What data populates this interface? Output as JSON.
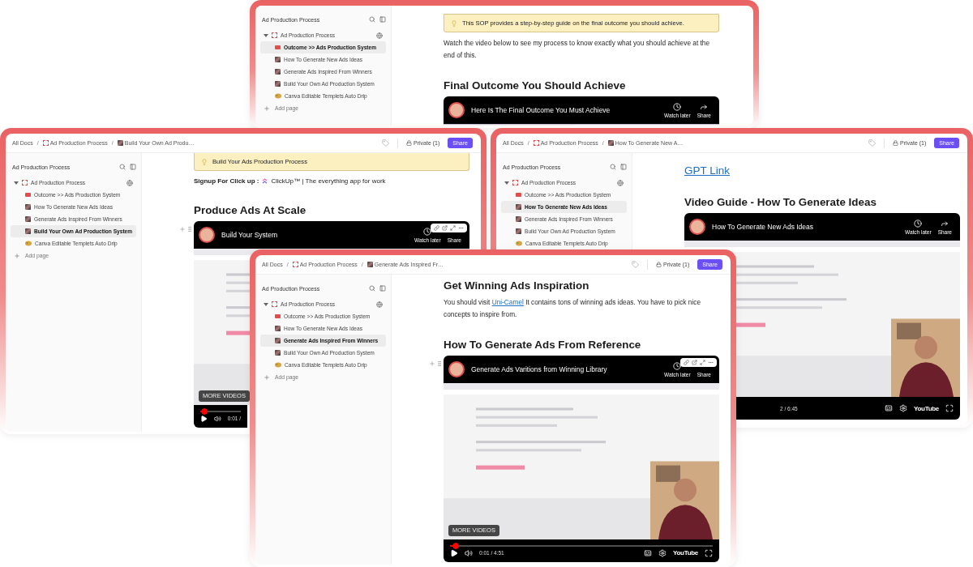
{
  "windows": [
    {
      "sidebar": {
        "title": "Ad Production Process",
        "root": {
          "label": "Ad Production Process",
          "expanded": true,
          "children": [
            {
              "label": "Outcome >> Ads Production System",
              "kind": "card",
              "selected": true
            },
            {
              "label": "How To Generate New Ads Ideas",
              "kind": "thumb",
              "selected": false
            },
            {
              "label": "Generate Ads Inspired From Winners",
              "kind": "thumb",
              "selected": false
            },
            {
              "label": "Build Your Own Ad Production System",
              "kind": "thumb",
              "selected": false
            },
            {
              "label": "Canva Editable Templets Auto Drip",
              "kind": "palette",
              "selected": false
            }
          ]
        },
        "add_page": "Add page"
      },
      "content": [
        {
          "kind": "callout",
          "text": "This SOP provides a step-by-step guide on the final outcome you should achieve."
        },
        {
          "kind": "paragraph",
          "parts": [
            {
              "text": "Watch the video below to see my process to know exactly what you should achieve at the end of this."
            }
          ]
        },
        {
          "kind": "heading",
          "text": "Final Outcome You Should Achieve"
        },
        {
          "kind": "video",
          "title": "Here Is The Final Outcome You Must Achieve",
          "watch_later": "Watch later",
          "share": "Share",
          "hovered": false
        }
      ]
    },
    {
      "topbar": {
        "breadcrumb": [
          {
            "kind": "plain",
            "label": "All Docs"
          },
          {
            "kind": "separator",
            "label": "/"
          },
          {
            "kind": "folder",
            "label": "Ad Production Process"
          },
          {
            "kind": "separator",
            "label": "/"
          },
          {
            "kind": "page",
            "label": "Build Your Own Ad Produ…"
          }
        ],
        "private": "Private (1)",
        "share": "Share"
      },
      "sidebar": {
        "title": "Ad Production Process",
        "root": {
          "label": "Ad Production Process",
          "expanded": true,
          "children": [
            {
              "label": "Outcome >> Ads Production System",
              "kind": "card",
              "selected": false
            },
            {
              "label": "How To Generate New Ads Ideas",
              "kind": "thumb",
              "selected": false
            },
            {
              "label": "Generate Ads Inspired From Winners",
              "kind": "thumb",
              "selected": false
            },
            {
              "label": "Build Your Own Ad Production System",
              "kind": "thumb",
              "selected": true
            },
            {
              "label": "Canva Editable Templets Auto Drip",
              "kind": "palette",
              "selected": false
            }
          ]
        },
        "add_page": "Add page"
      },
      "content": [
        {
          "kind": "callout",
          "text": "Build Your Ads Production Process"
        },
        {
          "kind": "signup",
          "label": "Signup For Click up :",
          "link": "ClickUp™ | The everything app for work"
        },
        {
          "kind": "heading",
          "text": "Produce Ads At Scale"
        },
        {
          "kind": "video",
          "title": "Build Your System",
          "watch_later": "Watch later",
          "share": "Share",
          "hovered": true,
          "more_videos": "MORE VIDEOS",
          "footer": {
            "level": 0.01,
            "items": [
              {
                "kind": "play"
              },
              {
                "kind": "volume"
              },
              {
                "kind": "time",
                "text": "0:01 /"
              }
            ]
          }
        }
      ]
    },
    {
      "topbar": {
        "breadcrumb": [
          {
            "kind": "plain",
            "label": "All Docs"
          },
          {
            "kind": "separator",
            "label": "/"
          },
          {
            "kind": "folder",
            "label": "Ad Production Process"
          },
          {
            "kind": "separator",
            "label": "/"
          },
          {
            "kind": "page",
            "label": "How To Generate New A…"
          }
        ],
        "private": "Private (1)",
        "share": "Share"
      },
      "sidebar": {
        "title": "Ad Production Process",
        "root": {
          "label": "Ad Production Process",
          "expanded": true,
          "children": [
            {
              "label": "Outcome >> Ads Production System",
              "kind": "card",
              "selected": false
            },
            {
              "label": "How To Generate New Ads Ideas",
              "kind": "thumb",
              "selected": true
            },
            {
              "label": "Generate Ads Inspired From Winners",
              "kind": "thumb",
              "selected": false
            },
            {
              "label": "Build Your Own Ad Production System",
              "kind": "thumb",
              "selected": false
            },
            {
              "label": "Canva Editable Templets Auto Drip",
              "kind": "palette",
              "selected": false
            }
          ]
        }
      },
      "content": [
        {
          "kind": "link_heading",
          "text": "GPT Link"
        },
        {
          "kind": "heading",
          "text": "Video Guide - How To Generate Ideas"
        },
        {
          "kind": "video",
          "title": "How To Generate New Ads Ideas",
          "watch_later": "Watch later",
          "share": "Share",
          "hovered": false,
          "footer": {
            "items": [
              {
                "kind": "time",
                "text": "2 / 6:45"
              },
              {
                "kind": "cc"
              },
              {
                "kind": "settings"
              },
              {
                "kind": "logo",
                "text": "YouTube"
              },
              {
                "kind": "fullscreen"
              }
            ]
          }
        }
      ]
    },
    {
      "topbar": {
        "breadcrumb": [
          {
            "kind": "plain",
            "label": "All Docs"
          },
          {
            "kind": "separator",
            "label": "/"
          },
          {
            "kind": "folder",
            "label": "Ad Production Process"
          },
          {
            "kind": "separator",
            "label": "/"
          },
          {
            "kind": "page",
            "label": "Generate Ads Inspired Fr…"
          }
        ],
        "private": "Private (1)",
        "share": "Share"
      },
      "sidebar": {
        "title": "Ad Production Process",
        "root": {
          "label": "Ad Production Process",
          "expanded": true,
          "children": [
            {
              "label": "Outcome >> Ads Production System",
              "kind": "card",
              "selected": false
            },
            {
              "label": "How To Generate New Ads Ideas",
              "kind": "thumb",
              "selected": false
            },
            {
              "label": "Generate Ads Inspired From Winners",
              "kind": "thumb",
              "selected": true
            },
            {
              "label": "Build Your Own Ad Production System",
              "kind": "thumb",
              "selected": false
            },
            {
              "label": "Canva Editable Templets Auto Drip",
              "kind": "palette",
              "selected": false
            }
          ]
        },
        "add_page": "Add page"
      },
      "content": [
        {
          "kind": "heading",
          "text": "Get Winning Ads Inspiration"
        },
        {
          "kind": "paragraph",
          "parts": [
            {
              "text": "You should visit "
            },
            {
              "text": "Uni-Camel",
              "link": true
            },
            {
              "text": " It contains tons of winning ads ideas. You have to pick nice concepts to inspire from."
            }
          ]
        },
        {
          "kind": "heading",
          "text": "How To Generate Ads From Reference"
        },
        {
          "kind": "video",
          "title": "Generate Ads Varitions from Winning Library",
          "watch_later": "Watch later",
          "share": "Share",
          "hovered": true,
          "more_videos": "MORE VIDEOS",
          "footer": {
            "level": 0.01,
            "items": [
              {
                "kind": "play"
              },
              {
                "kind": "volume"
              },
              {
                "kind": "time",
                "text": "0:01 / 4:51"
              },
              {
                "kind": "cc"
              },
              {
                "kind": "settings"
              },
              {
                "kind": "logo",
                "text": "YouTube"
              },
              {
                "kind": "fullscreen"
              }
            ]
          }
        }
      ]
    }
  ]
}
